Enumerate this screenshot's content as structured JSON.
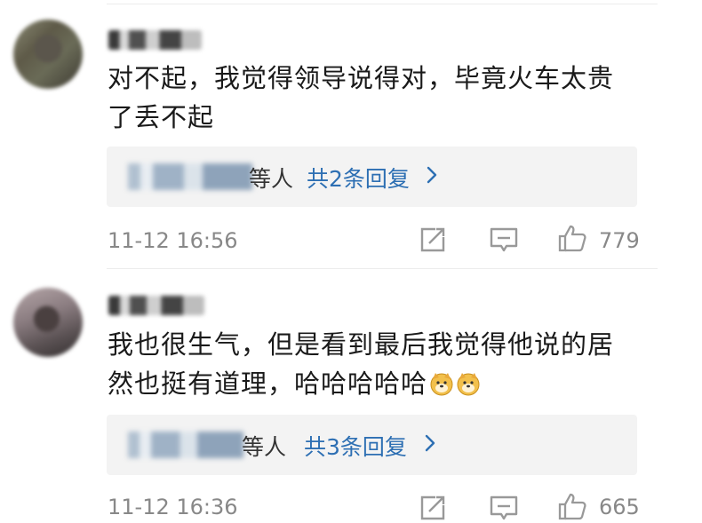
{
  "comments": [
    {
      "text_line1": "对不起，我觉得领导说得对，毕竟火车太贵",
      "text_line2": "了丢不起",
      "reply_etc": "等人",
      "reply_count": "共2条回复",
      "timestamp": "11-12 16:56",
      "likes": "779"
    },
    {
      "text_line1": "我也很生气，但是看到最后我觉得他说的居",
      "text_line2": "然也挺有道理，哈哈哈哈哈",
      "reply_etc": "等人",
      "reply_count": "共3条回复",
      "timestamp": "11-12 16:36",
      "likes": "665"
    }
  ],
  "icons": {
    "share": "share-icon",
    "reply": "comment-icon",
    "like": "thumbs-up-icon",
    "arrow": "chevron-right-icon",
    "emoji": "doge-emoji-icon"
  },
  "colors": {
    "link": "#2d6fb3",
    "meta": "#888888",
    "reply_bg": "#f3f3f3"
  }
}
